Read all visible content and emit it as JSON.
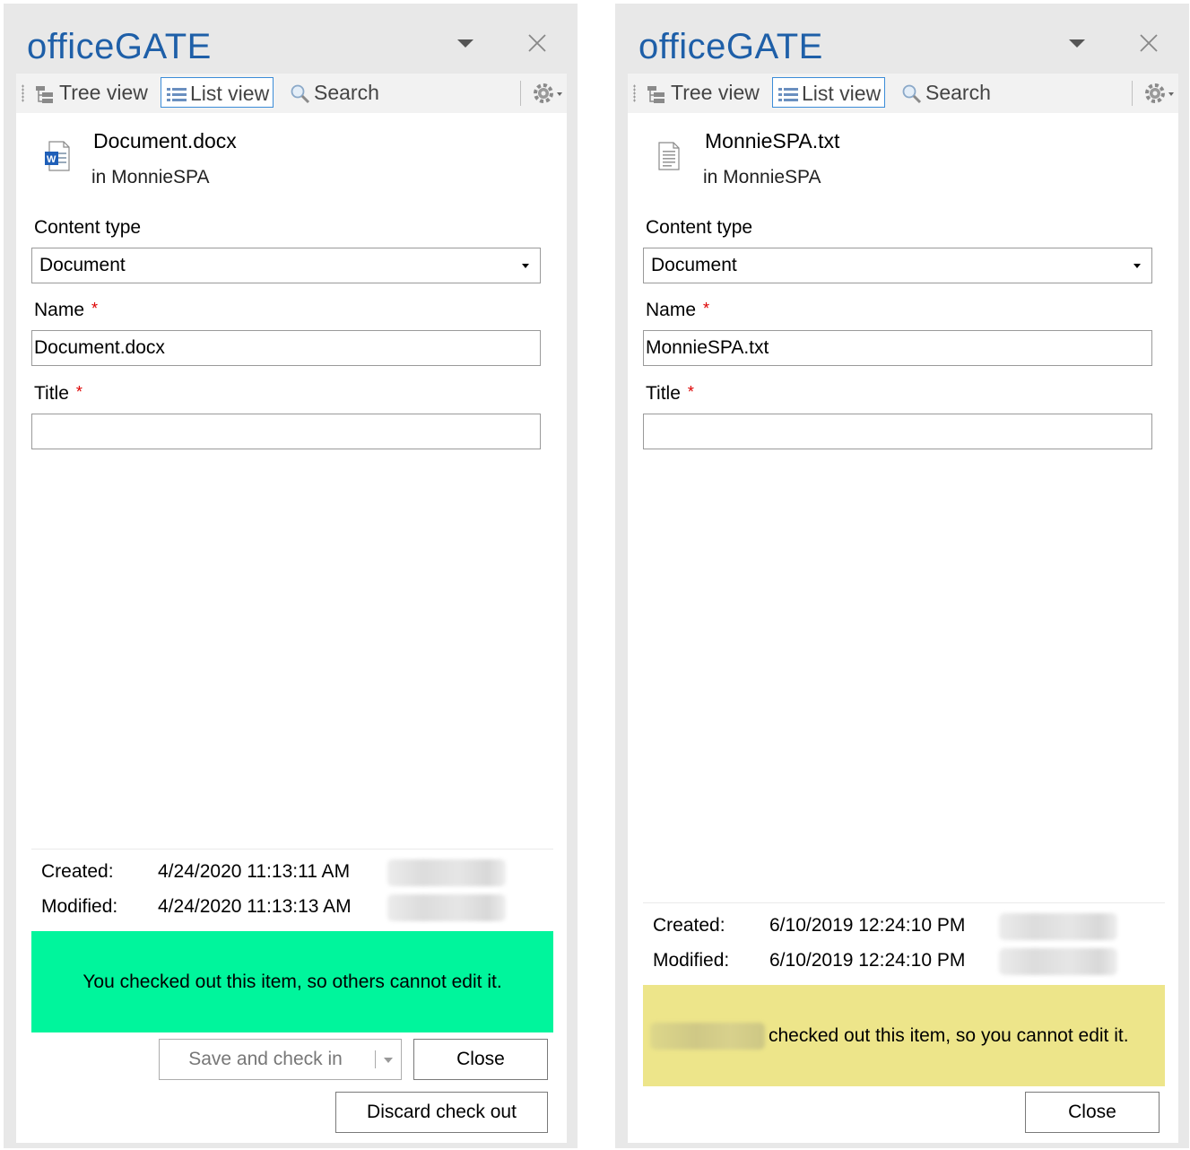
{
  "panels": [
    {
      "app_title": "officeGATE",
      "toolbar": {
        "tree_view": "Tree view",
        "list_view": "List view",
        "search": "Search"
      },
      "file": {
        "name": "Document.docx",
        "location": "in MonnieSPA",
        "icon": "word-document-icon"
      },
      "form": {
        "content_type_label": "Content type",
        "content_type_value": "Document",
        "name_label": "Name",
        "name_value": "Document.docx",
        "title_label": "Title",
        "title_value": "",
        "required_mark": "*"
      },
      "meta": {
        "created_label": "Created:",
        "created_value": "4/24/2020 11:13:11 AM",
        "modified_label": "Modified:",
        "modified_value": "4/24/2020 11:13:13 AM"
      },
      "banner": {
        "text": "You checked out this item, so others cannot edit it.",
        "color": "#00f59c"
      },
      "buttons": {
        "save_check_in": "Save and check in",
        "close": "Close",
        "discard": "Discard check out"
      }
    },
    {
      "app_title": "officeGATE",
      "toolbar": {
        "tree_view": "Tree view",
        "list_view": "List view",
        "search": "Search"
      },
      "file": {
        "name": "MonnieSPA.txt",
        "location": "in MonnieSPA",
        "icon": "text-document-icon"
      },
      "form": {
        "content_type_label": "Content type",
        "content_type_value": "Document",
        "name_label": "Name",
        "name_value": "MonnieSPA.txt",
        "title_label": "Title",
        "title_value": "",
        "required_mark": "*"
      },
      "meta": {
        "created_label": "Created:",
        "created_value": "6/10/2019 12:24:10 PM",
        "modified_label": "Modified:",
        "modified_value": "6/10/2019 12:24:10 PM"
      },
      "banner": {
        "text": "checked out this item, so you cannot edit it.",
        "color": "#ede58a"
      },
      "buttons": {
        "close": "Close"
      }
    }
  ],
  "colors": {
    "brand": "#1e5fa8",
    "active_border": "#3b8cd8",
    "required": "#dd0000"
  }
}
